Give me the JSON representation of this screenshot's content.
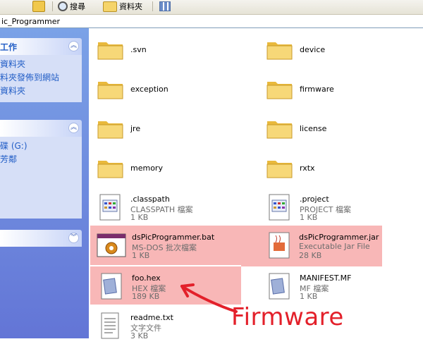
{
  "toolbar": {
    "search_label": "搜尋",
    "folders_label": "資料夾"
  },
  "address": {
    "path": "ic_Programmer"
  },
  "taskpane": {
    "panels": [
      {
        "title": "工作",
        "links": [
          "資料夾",
          "料夾發佈到網站",
          "資料夾"
        ],
        "toggle": "up"
      },
      {
        "title": "",
        "links": [
          "碟 (G:)",
          "",
          "",
          "芳鄰"
        ],
        "toggle": "up"
      },
      {
        "title": "",
        "links": [],
        "toggle": "down"
      }
    ]
  },
  "files": [
    {
      "name": ".svn",
      "kind": "folder"
    },
    {
      "name": "device",
      "kind": "folder"
    },
    {
      "name": "exception",
      "kind": "folder"
    },
    {
      "name": "firmware",
      "kind": "folder"
    },
    {
      "name": "jre",
      "kind": "folder"
    },
    {
      "name": "license",
      "kind": "folder"
    },
    {
      "name": "memory",
      "kind": "folder"
    },
    {
      "name": "rxtx",
      "kind": "folder"
    },
    {
      "name": ".classpath",
      "type": "CLASSPATH 檔案",
      "size": "1 KB",
      "kind": "text"
    },
    {
      "name": ".project",
      "type": "PROJECT 檔案",
      "size": "1 KB",
      "kind": "text"
    },
    {
      "name": "dsPicProgrammer.bat",
      "type": "MS-DOS 批次檔案",
      "size": "1 KB",
      "kind": "bat"
    },
    {
      "name": "dsPicProgrammer.jar",
      "type": "Executable Jar File",
      "size": "28 KB",
      "kind": "jar"
    },
    {
      "name": "foo.hex",
      "type": "HEX 檔案",
      "size": "189 KB",
      "kind": "hex"
    },
    {
      "name": "MANIFEST.MF",
      "type": "MF 檔案",
      "size": "1 KB",
      "kind": "mf"
    },
    {
      "name": "readme.txt",
      "type": "文字文件",
      "size": "3 KB",
      "kind": "txt"
    }
  ],
  "annotation": {
    "text": "Firmware",
    "color": "#e3202a"
  },
  "colors": {
    "highlight": "#f8b7b7",
    "taskpane_top": "#7ba2e7",
    "taskpane_bottom": "#6375d6",
    "link": "#215dc6"
  }
}
